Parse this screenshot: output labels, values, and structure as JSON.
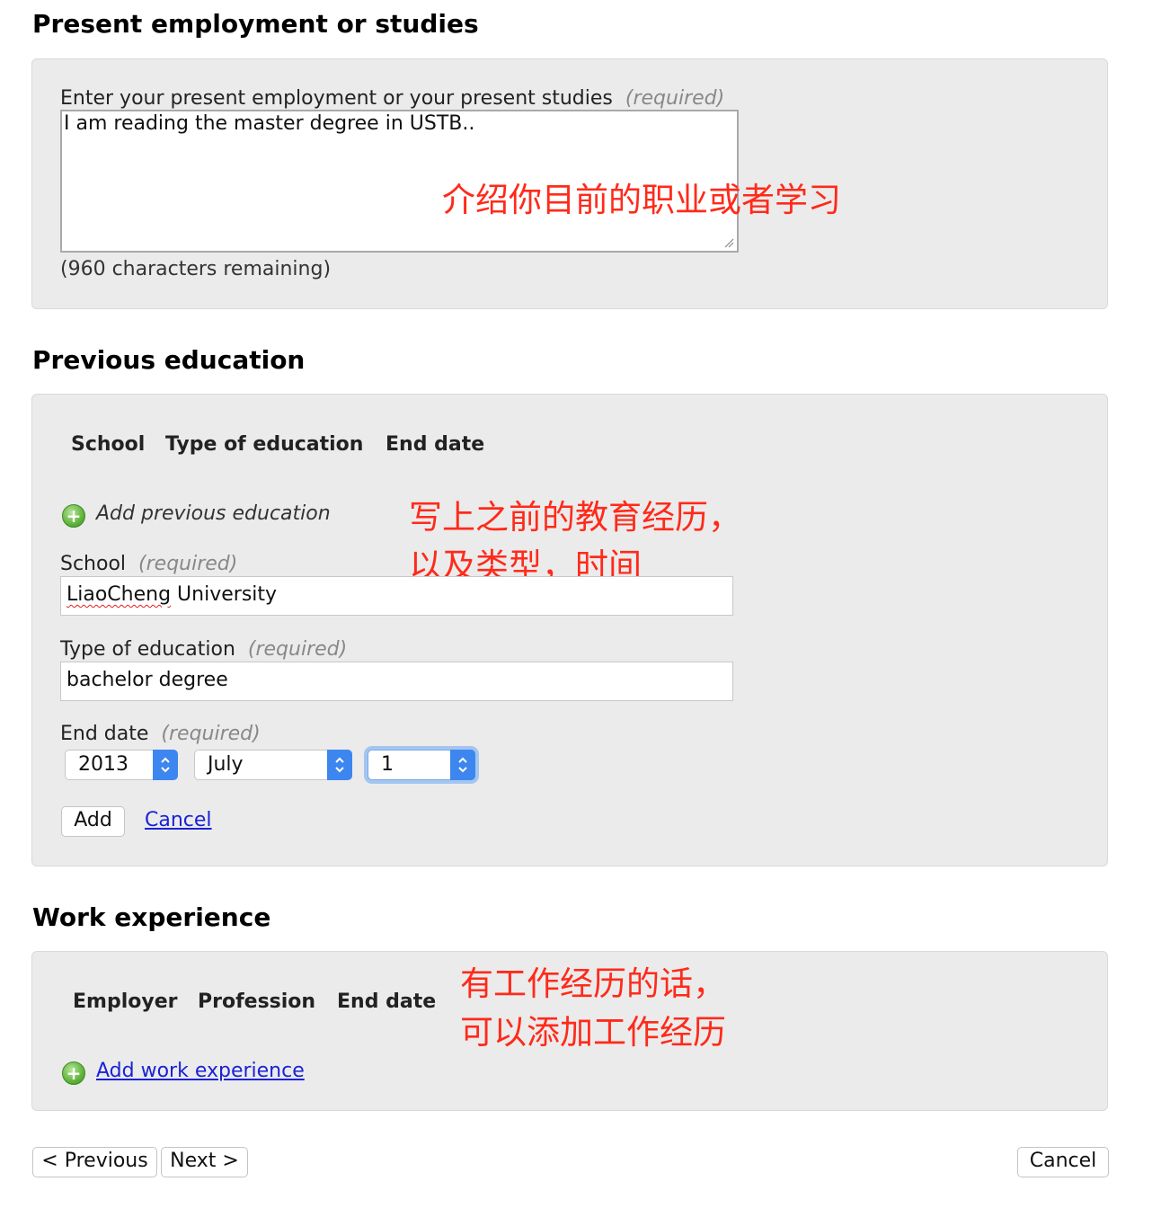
{
  "employment": {
    "heading": "Present employment or studies",
    "field_label": "Enter your present employment or your present studies",
    "required": "(required)",
    "value": "I am reading the master degree in USTB..",
    "remaining": "(960 characters remaining)",
    "annotation": "介绍你目前的职业或者学习"
  },
  "education": {
    "heading": "Previous education",
    "columns": [
      "School",
      "Type of education",
      "End date"
    ],
    "add_link": "Add previous education",
    "annotation_lines": [
      "写上之前的教育经历，",
      "以及类型，时间"
    ],
    "school_label": "School",
    "school_value": "LiaoCheng University",
    "school_value_misspelled_part": "LiaoCheng",
    "school_value_rest": " University",
    "type_label": "Type of education",
    "type_value": "bachelor degree",
    "end_label": "End date",
    "required": "(required)",
    "end_year": "2013",
    "end_month": "July",
    "end_day": "1",
    "add_button": "Add",
    "cancel_link": "Cancel"
  },
  "work": {
    "heading": "Work experience",
    "columns": [
      "Employer",
      "Profession",
      "End date"
    ],
    "add_link": "Add work experience",
    "annotation_lines": [
      "有工作经历的话，",
      "可以添加工作经历"
    ]
  },
  "footer": {
    "previous": "< Previous",
    "next": "Next >",
    "cancel": "Cancel"
  },
  "colors": {
    "annotation": "#ff2a1a",
    "link": "#1a22d6",
    "panel_bg": "#ebebeb",
    "spinner": "#3d86ef"
  }
}
